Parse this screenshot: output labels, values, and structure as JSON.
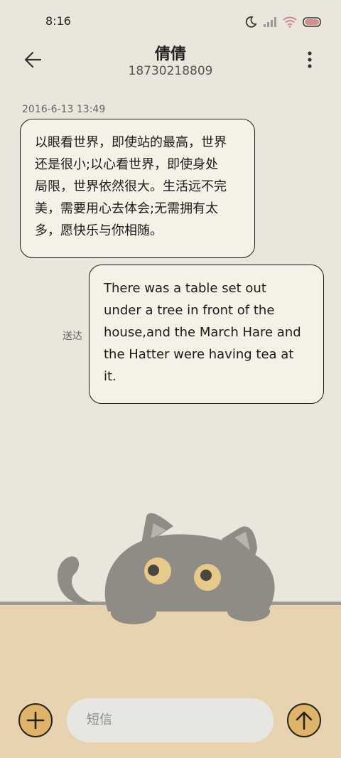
{
  "status_bar": {
    "time": "8:16",
    "icons": [
      "moon-icon",
      "signal-icon",
      "wifi-icon",
      "battery-icon"
    ]
  },
  "header": {
    "contact_name": "倩倩",
    "contact_number": "18730218809",
    "back_icon": "arrow-left-icon",
    "menu_icon": "more-vertical-icon"
  },
  "conversation": {
    "timestamp": "2016-6-13 13:49",
    "incoming": {
      "lines": [
        "以眼看世界，即使站的最高，世界",
        "还是很小;以心看世界，即使身处",
        "局限，世界依然很大。生活远不完",
        "美，需要用心去体会;无需拥有太",
        "多，愿快乐与你相随。"
      ]
    },
    "outgoing": {
      "lines": [
        "There was a table set out",
        "under a tree in front of the",
        "house,and the March Hare and",
        "the Hatter were having tea at",
        "it."
      ],
      "status": "送达"
    }
  },
  "composer": {
    "placeholder": "短信",
    "add_icon": "plus-icon",
    "send_icon": "arrow-up-icon"
  },
  "colors": {
    "background": "#ebe6dc",
    "bubble_border": "#1c1c1c",
    "accent": "#deb36a",
    "table": "#e8d3b0",
    "cat": "#8f8b85"
  }
}
